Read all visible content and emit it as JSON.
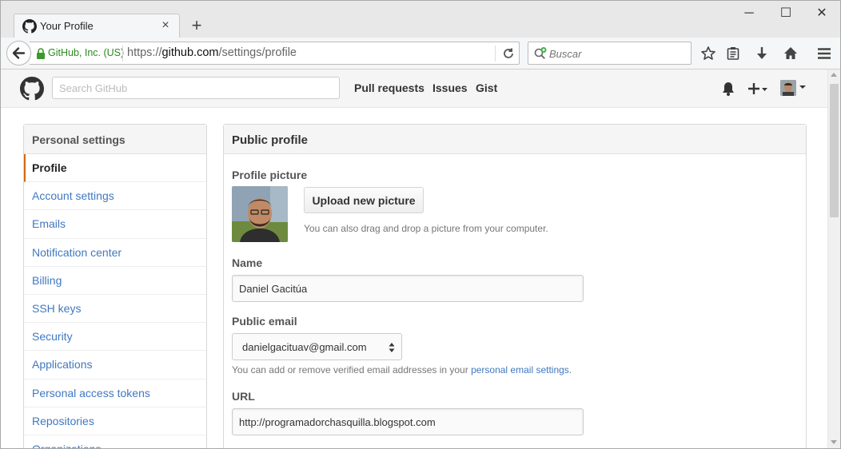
{
  "browser": {
    "tab_title": "Your Profile",
    "tab_close": "×",
    "new_tab": "+",
    "site_identity": "GitHub, Inc. (US)",
    "url_prefix": "https://",
    "url_domain": "github.com",
    "url_path": "/settings/profile",
    "search_placeholder": "Buscar",
    "win_minimize": "─",
    "win_maximize": "☐",
    "win_close": "✕"
  },
  "github_header": {
    "search_placeholder": "Search GitHub",
    "nav": [
      "Pull requests",
      "Issues",
      "Gist"
    ]
  },
  "sidebar": {
    "title": "Personal settings",
    "items": [
      {
        "label": "Profile",
        "selected": true
      },
      {
        "label": "Account settings"
      },
      {
        "label": "Emails"
      },
      {
        "label": "Notification center"
      },
      {
        "label": "Billing"
      },
      {
        "label": "SSH keys"
      },
      {
        "label": "Security"
      },
      {
        "label": "Applications"
      },
      {
        "label": "Personal access tokens"
      },
      {
        "label": "Repositories"
      },
      {
        "label": "Organizations"
      }
    ]
  },
  "profile": {
    "panel_title": "Public profile",
    "picture_label": "Profile picture",
    "upload_button": "Upload new picture",
    "upload_hint": "You can also drag and drop a picture from your computer.",
    "name_label": "Name",
    "name_value": "Daniel Gacitúa",
    "email_label": "Public email",
    "email_value": "danielgacituav@gmail.com",
    "email_hint_prefix": "You can add or remove verified email addresses in your ",
    "email_hint_link": "personal email settings",
    "email_hint_suffix": ".",
    "url_label": "URL",
    "url_value": "http://programadorchasquilla.blogspot.com"
  },
  "colors": {
    "link": "#4078c0",
    "selected_accent": "#d26911",
    "secure_green": "#2b8a1e"
  },
  "icons": [
    "github-favicon-icon",
    "back-arrow-icon",
    "lock-icon",
    "reload-icon",
    "search-engine-icon",
    "bookmark-star-icon",
    "reading-list-icon",
    "download-icon",
    "home-icon",
    "menu-icon",
    "github-logo-icon",
    "bell-icon",
    "plus-icon",
    "caret-down-icon",
    "select-caret-icon"
  ]
}
